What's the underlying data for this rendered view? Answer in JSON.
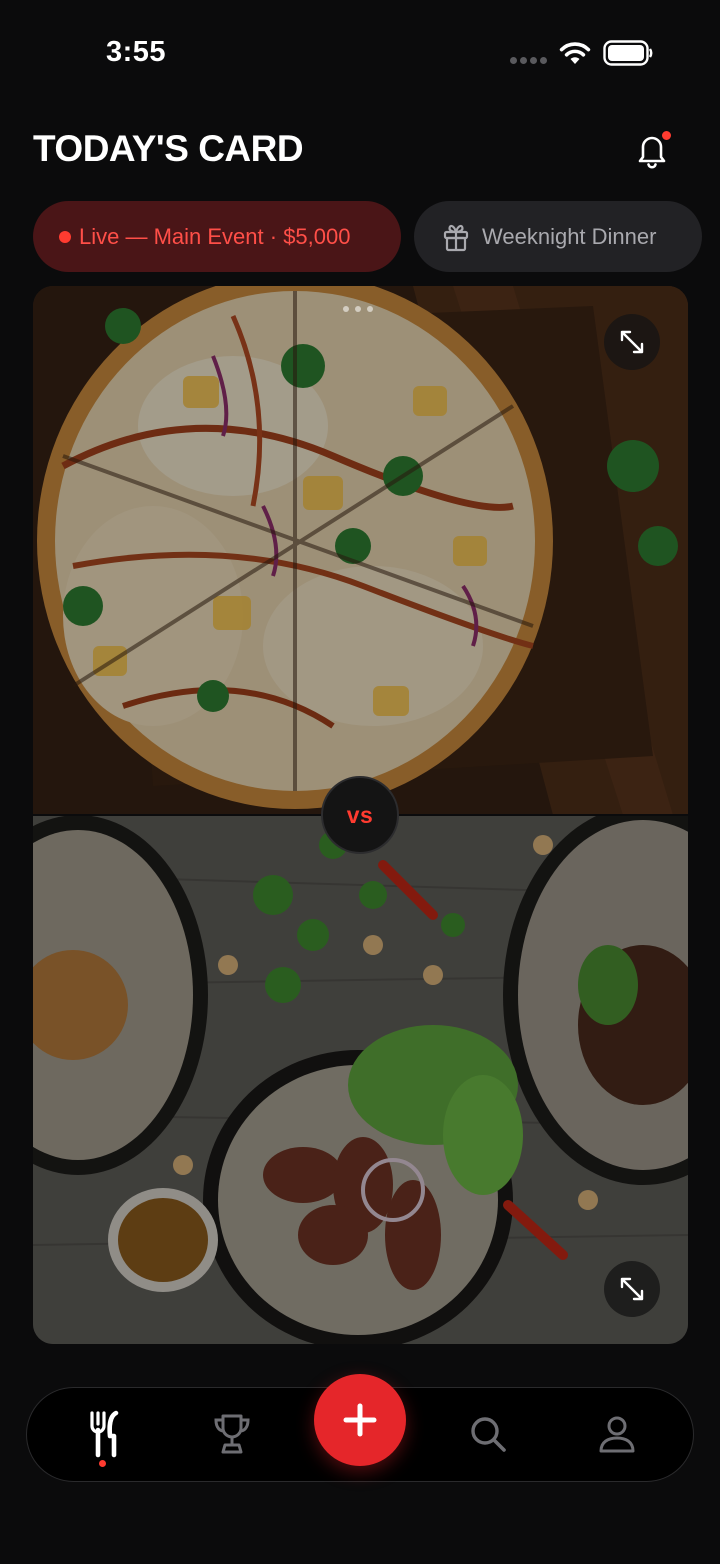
{
  "status_bar": {
    "time": "3:55",
    "icons": [
      "cellular-signal-icon",
      "wifi-icon",
      "battery-icon"
    ]
  },
  "header": {
    "title": "TODAY'S CARD",
    "notifications_icon": "bell-icon",
    "has_unread_notifications": true
  },
  "chips": {
    "live": {
      "label": "Live — Main Event · $5,000",
      "icon": "live-dot"
    },
    "secondary": {
      "label": "Weeknight Dinner",
      "icon": "gift-icon"
    }
  },
  "matchup": {
    "vs_label": "vs",
    "top_dish": {
      "image": "pizza-photo",
      "action_icon": "expand-icon"
    },
    "bottom_dish": {
      "image": "steak-salad-photo",
      "action_icon": "expand-icon"
    },
    "pager_count": 3
  },
  "tab_bar": {
    "items": [
      {
        "name": "menu",
        "icon": "fork-knife-icon",
        "active": true
      },
      {
        "name": "leaderboard",
        "icon": "trophy-icon",
        "active": false
      },
      {
        "name": "add",
        "icon": "plus-icon",
        "active": false
      },
      {
        "name": "search",
        "icon": "search-icon",
        "active": false
      },
      {
        "name": "profile",
        "icon": "profile-icon",
        "active": false
      }
    ]
  },
  "colors": {
    "background": "#0b0b0c",
    "accent": "#e5262a",
    "live_chip_bg": "#4a1517",
    "live_text": "#ff4f48",
    "chip_bg": "#222225"
  }
}
